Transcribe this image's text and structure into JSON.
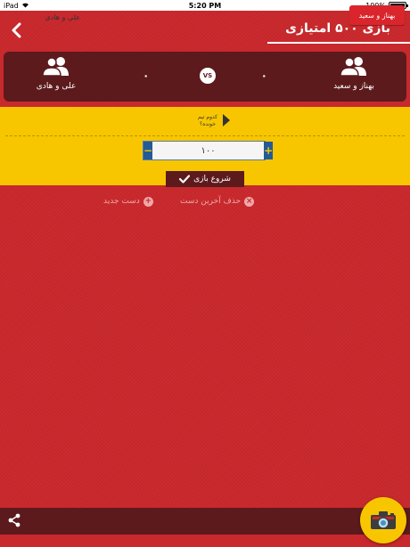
{
  "status_bar": {
    "carrier": "iPad",
    "time": "5:20 PM",
    "battery": "100%"
  },
  "header": {
    "title": "بازی ۵۰۰ امتیازی"
  },
  "scoreboard": {
    "team_right_name": "بهناز و سعید",
    "team_left_name": "علی و هادی",
    "team_right_score": "۰",
    "team_left_score": "۰",
    "vs_label": "VS"
  },
  "panel": {
    "team_right_button": "بهناز و سعید",
    "team_left_button": "علی و هادی",
    "which_team_line1": "کدوم تیم",
    "which_team_line2": "خونده؟",
    "stepper_value": "۱۰۰",
    "minus_label": "−",
    "plus_label": "+",
    "start_button": "شروع بازی"
  },
  "actions": {
    "delete_last_hand": "حذف آخرین دست",
    "new_hand": "دست جدید"
  },
  "colors": {
    "background": "#c9282c",
    "dark": "#5c1a1c",
    "yellow": "#f7c600",
    "blue": "#245a96"
  },
  "icons": {
    "back": "chevron-left-icon",
    "team": "users-icon",
    "share": "share-icon",
    "camera": "camera-icon",
    "check": "check-icon"
  }
}
